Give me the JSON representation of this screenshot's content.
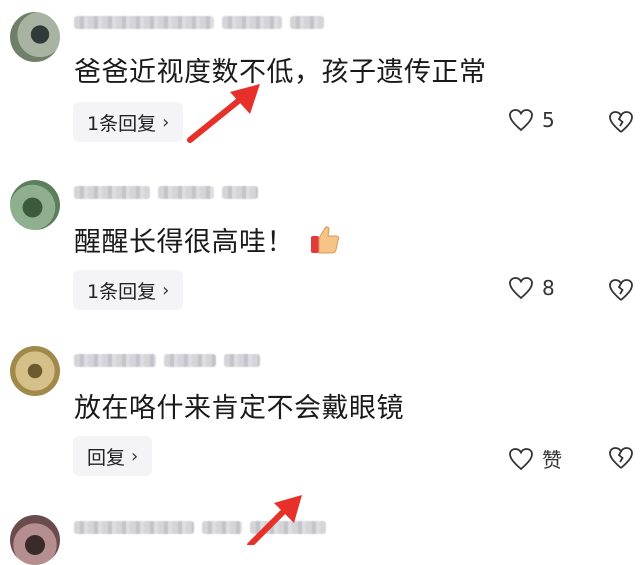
{
  "comments": [
    {
      "text": "爸爸近视度数不低，孩子遗传正常",
      "reply_label": "1条回复",
      "like_count": "5",
      "avatar": {
        "icon": "avatar-blurred",
        "colors": [
          "#6f7f6a",
          "#a9b3a2",
          "#2f3a3a"
        ]
      }
    },
    {
      "text": "醒醒长得很高哇！",
      "emoji_icon": "thumbs-up-icon",
      "reply_label": "1条回复",
      "like_count": "8",
      "avatar": {
        "icon": "avatar-blurred",
        "colors": [
          "#5a7f5a",
          "#8fb08f",
          "#3c5a3c"
        ]
      }
    },
    {
      "text": "放在咯什来肯定不会戴眼镜",
      "reply_label": "回复",
      "like_count": "赞",
      "avatar": {
        "icon": "avatar-blurred",
        "colors": [
          "#a0894a",
          "#d6c08a",
          "#6b5a2e"
        ]
      }
    },
    {
      "avatar": {
        "icon": "avatar-blurred",
        "colors": [
          "#6b4c4c",
          "#b58f8f",
          "#3a2a2a"
        ]
      }
    }
  ],
  "icons": {
    "like": "heart-outline-icon",
    "dislike": "broken-heart-icon",
    "chevron": "chevron-right-icon",
    "annotation": "red-arrow-icon"
  },
  "colors": {
    "accent_arrow": "#e8302a",
    "reply_bg": "#f4f4f6",
    "text": "#1a1a1a"
  }
}
